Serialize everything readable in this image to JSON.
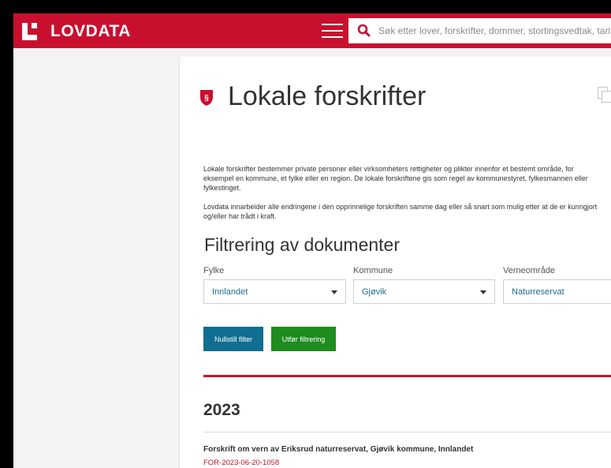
{
  "header": {
    "logo_text": "LOVDATA",
    "search_placeholder": "Søk etter lover, forskrifter, dommer, stortingsvedtak, tariffavtaler"
  },
  "page": {
    "title": "Lokale forskrifter",
    "intro_paragraph_1": "Lokale forskrifter bestemmer private personer eller virksomheters rettigheter og plikter innenfor et bestemt område, for eksempel en kommune, et fylke eller en region. De lokale forskriftene gis som regel av kommunestyret, fylkesmannen eller fylkestinget.",
    "intro_paragraph_2": "Lovdata innarbeider alle endringene i den opprinnelige forskriften samme dag eller så snart som mulig etter at de er kunngjort og/eller har trådt i kraft."
  },
  "filter": {
    "heading": "Filtrering av dokumenter",
    "fylke": {
      "label": "Fylke",
      "value": "Innlandet"
    },
    "kommune": {
      "label": "Kommune",
      "value": "Gjøvik"
    },
    "verneomrade": {
      "label": "Verneområde",
      "value": "Naturreservat"
    },
    "reset_button": "Nullstill filter",
    "apply_button": "Utfør filtrering"
  },
  "results": {
    "year": "2023",
    "items": [
      {
        "title": "Forskrift om vern av Eriksrud naturreservat, Gjøvik kommune, Innlandet",
        "id": "FOR-2023-06-20-1058"
      }
    ]
  },
  "colors": {
    "brand_red": "#c8102e",
    "reset_button": "#0f6e91",
    "apply_button": "#1e8c1e",
    "select_text": "#1f6b8a"
  },
  "icons": [
    "lovdata-logo-icon",
    "menu-icon",
    "search-icon",
    "paragraph-shield-icon",
    "copy-icon",
    "chevron-down-icon"
  ]
}
